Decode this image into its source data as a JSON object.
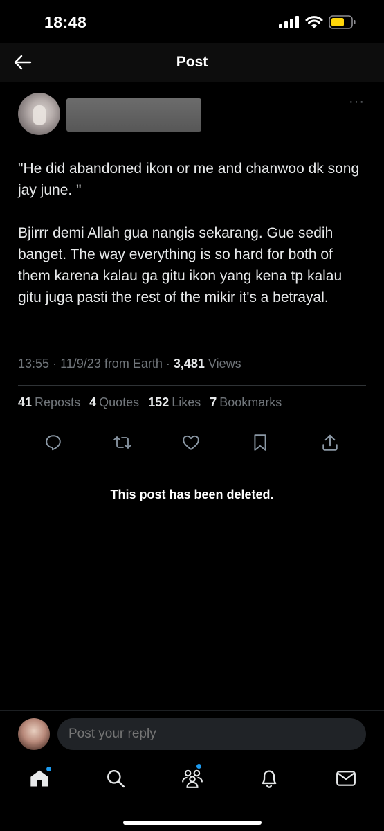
{
  "status_bar": {
    "time": "18:48",
    "icons": [
      "cellular-signal-icon",
      "wifi-icon",
      "battery-icon"
    ],
    "battery_color": "#ffd60a"
  },
  "nav": {
    "title": "Post"
  },
  "post": {
    "more_label": "···",
    "text_paragraphs": [
      "\"He did abandoned ikon or me and chanwoo dk song jay june. \"",
      "Bjirrr demi Allah gua nangis sekarang. Gue sedih banget. The way everything is so hard for both of them karena kalau ga gitu ikon yang kena tp kalau gitu juga pasti the rest of the mikir it's a betrayal."
    ],
    "time": "13:55",
    "date": "11/9/23",
    "source": "from Earth",
    "views_count": "3,481",
    "views_label": "Views",
    "stats": {
      "reposts_count": "41",
      "reposts_label": "Reposts",
      "quotes_count": "4",
      "quotes_label": "Quotes",
      "likes_count": "152",
      "likes_label": "Likes",
      "bookmarks_count": "7",
      "bookmarks_label": "Bookmarks"
    },
    "actions": [
      "reply-icon",
      "repost-icon",
      "like-icon",
      "bookmark-icon",
      "share-icon"
    ],
    "deleted_notice": "This post has been deleted."
  },
  "reply": {
    "placeholder": "Post your reply"
  },
  "tabbar": {
    "tabs": [
      "home-icon",
      "search-icon",
      "communities-icon",
      "notifications-icon",
      "messages-icon"
    ],
    "accent": "#1d9bf0"
  }
}
